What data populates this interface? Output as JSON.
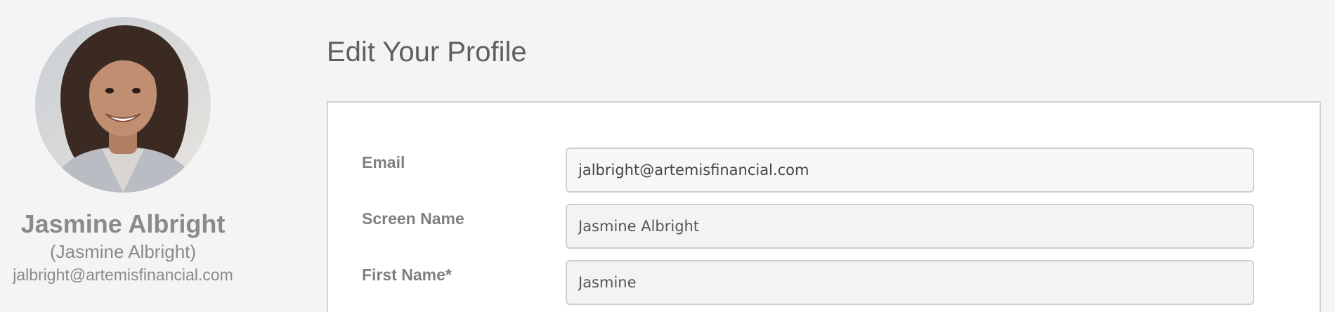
{
  "profile": {
    "avatar_icon": "profile-photo",
    "name": "Jasmine Albright",
    "screen_name": "(Jasmine Albright)",
    "email": "jalbright@artemisfinancial.com"
  },
  "page_title": "Edit Your Profile",
  "form": {
    "email": {
      "label": "Email",
      "value": "jalbright@artemisfinancial.com"
    },
    "screen_name": {
      "label": "Screen Name",
      "value": "Jasmine Albright"
    },
    "first_name": {
      "label": "First Name*",
      "value": "Jasmine"
    }
  }
}
